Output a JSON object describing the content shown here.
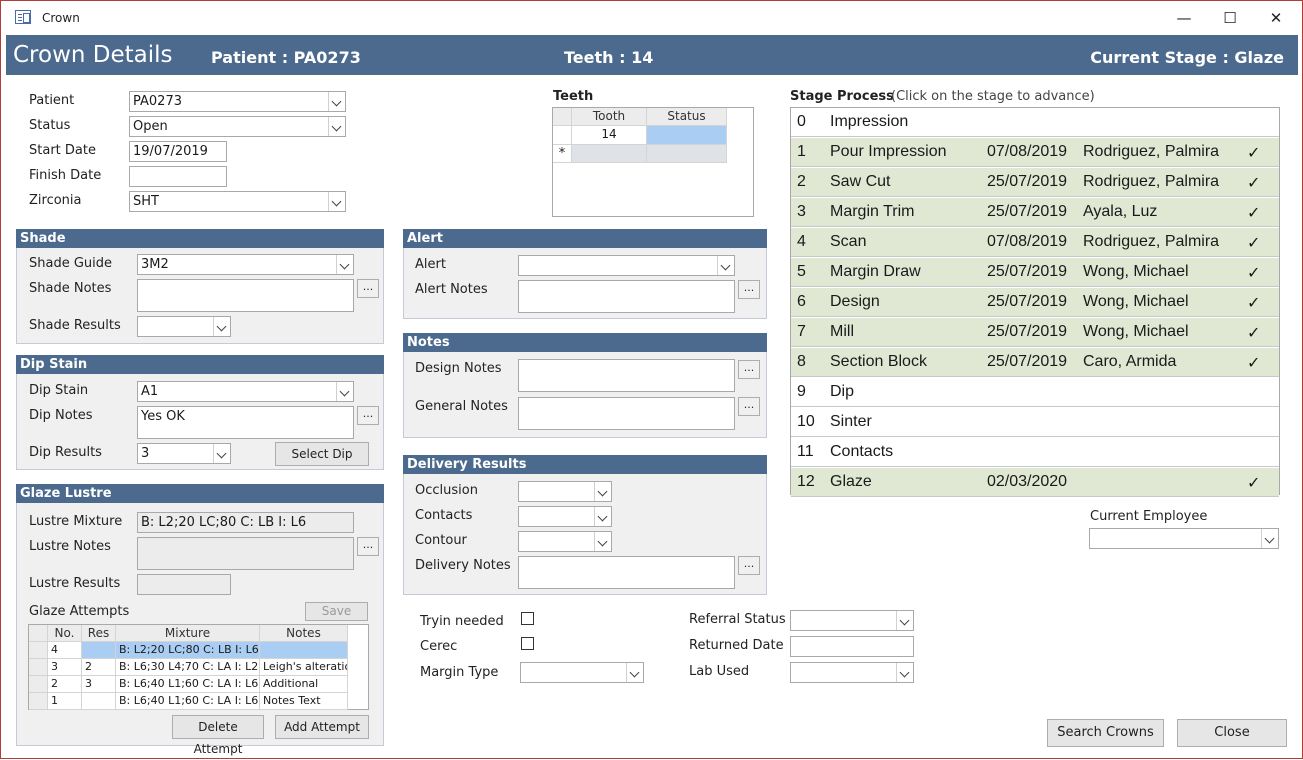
{
  "window": {
    "title": "Crown",
    "minimize": "—",
    "maximize": "☐",
    "close": "✕"
  },
  "header": {
    "title": "Crown Details",
    "patient": "Patient : PA0273",
    "teeth": "Teeth :  14",
    "stage": "Current Stage :  Glaze"
  },
  "details": {
    "patient_label": "Patient",
    "patient_value": "PA0273",
    "status_label": "Status",
    "status_value": "Open",
    "start_label": "Start Date",
    "start_value": "19/07/2019",
    "finish_label": "Finish Date",
    "finish_value": "",
    "zirconia_label": "Zirconia",
    "zirconia_value": "SHT"
  },
  "teeth": {
    "title": "Teeth",
    "col_tooth": "Tooth",
    "col_status": "Status",
    "row_tooth": "14",
    "new_row_marker": "*"
  },
  "stage_process": {
    "title": "Stage Process",
    "hint": "(Click on the stage to advance)",
    "check": "✓",
    "stages": [
      {
        "num": "0",
        "name": "Impression",
        "date": "",
        "person": "",
        "done": false
      },
      {
        "num": "1",
        "name": "Pour Impression",
        "date": "07/08/2019",
        "person": "Rodriguez, Palmira",
        "done": true
      },
      {
        "num": "2",
        "name": "Saw Cut",
        "date": "25/07/2019",
        "person": "Rodriguez, Palmira",
        "done": true
      },
      {
        "num": "3",
        "name": "Margin Trim",
        "date": "25/07/2019",
        "person": "Ayala, Luz",
        "done": true
      },
      {
        "num": "4",
        "name": "Scan",
        "date": "07/08/2019",
        "person": "Rodriguez, Palmira",
        "done": true
      },
      {
        "num": "5",
        "name": "Margin Draw",
        "date": "25/07/2019",
        "person": "Wong, Michael",
        "done": true
      },
      {
        "num": "6",
        "name": "Design",
        "date": "25/07/2019",
        "person": "Wong, Michael",
        "done": true
      },
      {
        "num": "7",
        "name": "Mill",
        "date": "25/07/2019",
        "person": "Wong, Michael",
        "done": true
      },
      {
        "num": "8",
        "name": "Section Block",
        "date": "25/07/2019",
        "person": "Caro, Armida",
        "done": true
      },
      {
        "num": "9",
        "name": "Dip",
        "date": "",
        "person": "",
        "done": false
      },
      {
        "num": "10",
        "name": "Sinter",
        "date": "",
        "person": "",
        "done": false
      },
      {
        "num": "11",
        "name": "Contacts",
        "date": "",
        "person": "",
        "done": false
      },
      {
        "num": "12",
        "name": "Glaze",
        "date": "02/03/2020",
        "person": "",
        "done": true
      }
    ]
  },
  "shade": {
    "title": "Shade",
    "guide_label": "Shade Guide",
    "guide_value": "3M2",
    "notes_label": "Shade Notes",
    "notes_value": "",
    "results_label": "Shade Results",
    "results_value": ""
  },
  "dip": {
    "title": "Dip Stain",
    "stain_label": "Dip Stain",
    "stain_value": "A1",
    "notes_label": "Dip Notes",
    "notes_value": "Yes OK",
    "results_label": "Dip Results",
    "results_value": "3",
    "select_button": "Select Dip"
  },
  "glaze": {
    "title": "Glaze Lustre",
    "mixture_label": "Lustre Mixture",
    "mixture_value": "B: L2;20 LC;80 C: LB I: L6",
    "notes_label": "Lustre Notes",
    "results_label": "Lustre Results",
    "attempts_label": "Glaze Attempts",
    "save_button": "Save",
    "columns": [
      "No.",
      "Res",
      "Mixture",
      "Notes"
    ],
    "rows": [
      {
        "no": "4",
        "res": "",
        "mixture": "B: L2;20 LC;80 C: LB I: L6",
        "notes": ""
      },
      {
        "no": "3",
        "res": "2",
        "mixture": "B: L6;30 L4;70 C: LA I: L2",
        "notes": "Leigh's alteration"
      },
      {
        "no": "2",
        "res": "3",
        "mixture": "B: L6;40 L1;60 C: LA I: L6",
        "notes": "Additional"
      },
      {
        "no": "1",
        "res": "",
        "mixture": "B: L6;40 L1;60 C: LA I: L6",
        "notes": "Notes Text"
      }
    ],
    "delete_button": "Delete Attempt",
    "add_button": "Add Attempt"
  },
  "alert": {
    "title": "Alert",
    "alert_label": "Alert",
    "alert_value": "",
    "notes_label": "Alert Notes"
  },
  "notes": {
    "title": "Notes",
    "design_label": "Design Notes",
    "general_label": "General Notes"
  },
  "delivery": {
    "title": "Delivery Results",
    "occlusion_label": "Occlusion",
    "contacts_label": "Contacts",
    "contour_label": "Contour",
    "notes_label": "Delivery Notes"
  },
  "extra": {
    "tryin_label": "Tryin needed",
    "cerec_label": "Cerec",
    "margin_label": "Margin Type",
    "referral_label": "Referral Status",
    "returned_label": "Returned Date",
    "lab_label": "Lab Used"
  },
  "employee": {
    "label": "Current Employee",
    "value": ""
  },
  "footer": {
    "search_button": "Search Crowns",
    "close_button": "Close"
  },
  "colors": {
    "header": "#4b6a8e",
    "done_row": "#e0e8d4",
    "selection": "#a9cdf3"
  }
}
